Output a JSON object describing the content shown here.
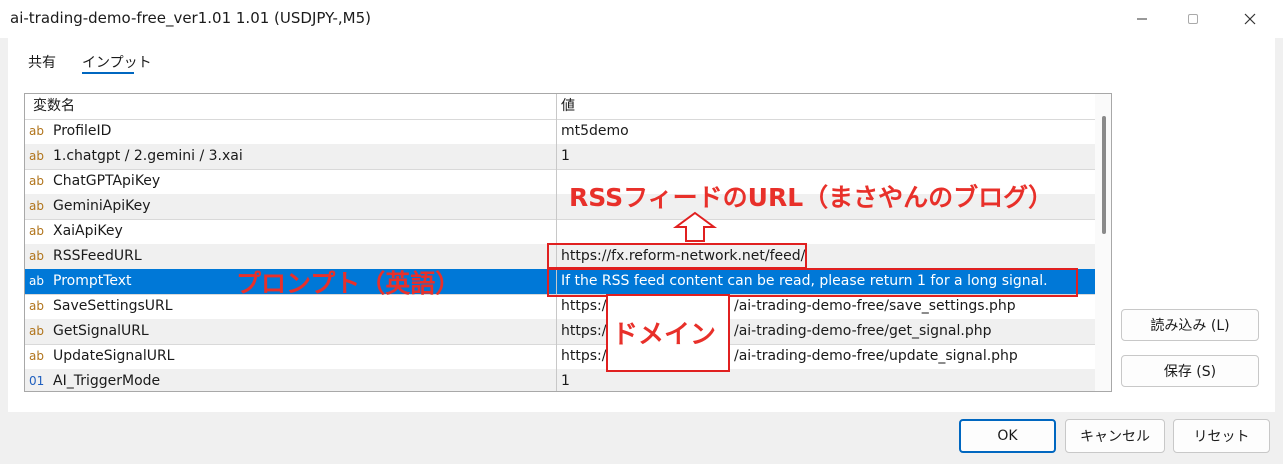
{
  "window": {
    "title": "ai-trading-demo-free_ver1.01 1.01 (USDJPY-,M5)"
  },
  "tabs": [
    {
      "label": "共有"
    },
    {
      "label": "インプット"
    }
  ],
  "table": {
    "headers": [
      "変数名",
      "値"
    ],
    "rows": [
      {
        "type": "ab",
        "name": "ProfileID",
        "value": "mt5demo"
      },
      {
        "type": "ab",
        "name": "1.chatgpt / 2.gemini / 3.xai",
        "value": "1"
      },
      {
        "type": "ab",
        "name": "ChatGPTApiKey",
        "value": ""
      },
      {
        "type": "ab",
        "name": "GeminiApiKey",
        "value": ""
      },
      {
        "type": "ab",
        "name": "XaiApiKey",
        "value": ""
      },
      {
        "type": "ab",
        "name": "RSSFeedURL",
        "value": "https://fx.reform-network.net/feed/"
      },
      {
        "type": "ab",
        "name": "PromptText",
        "value": "If the RSS feed content can be read, please return 1 for a long signal."
      },
      {
        "type": "ab",
        "name": "SaveSettingsURL",
        "value": "https://",
        "value_suffix": "/ai-trading-demo-free/save_settings.php"
      },
      {
        "type": "ab",
        "name": "GetSignalURL",
        "value": "https://",
        "value_suffix": "/ai-trading-demo-free/get_signal.php"
      },
      {
        "type": "ab",
        "name": "UpdateSignalURL",
        "value": "https://",
        "value_suffix": "/ai-trading-demo-free/update_signal.php"
      },
      {
        "type": "01",
        "name": "AI_TriggerMode",
        "value": "1"
      }
    ]
  },
  "annotations": {
    "rss_label": "RSSフィードのURL（まさやんのブログ）",
    "prompt_label": "プロンプト（英語）",
    "domain_label": "ドメイン"
  },
  "buttons": {
    "load": "読み込み (L)",
    "save": "保存 (S)",
    "ok": "OK",
    "cancel": "キャンセル",
    "reset": "リセット"
  },
  "colors": {
    "selection": "#0078d7",
    "annotation": "#e02020",
    "accent": "#0067c0"
  }
}
